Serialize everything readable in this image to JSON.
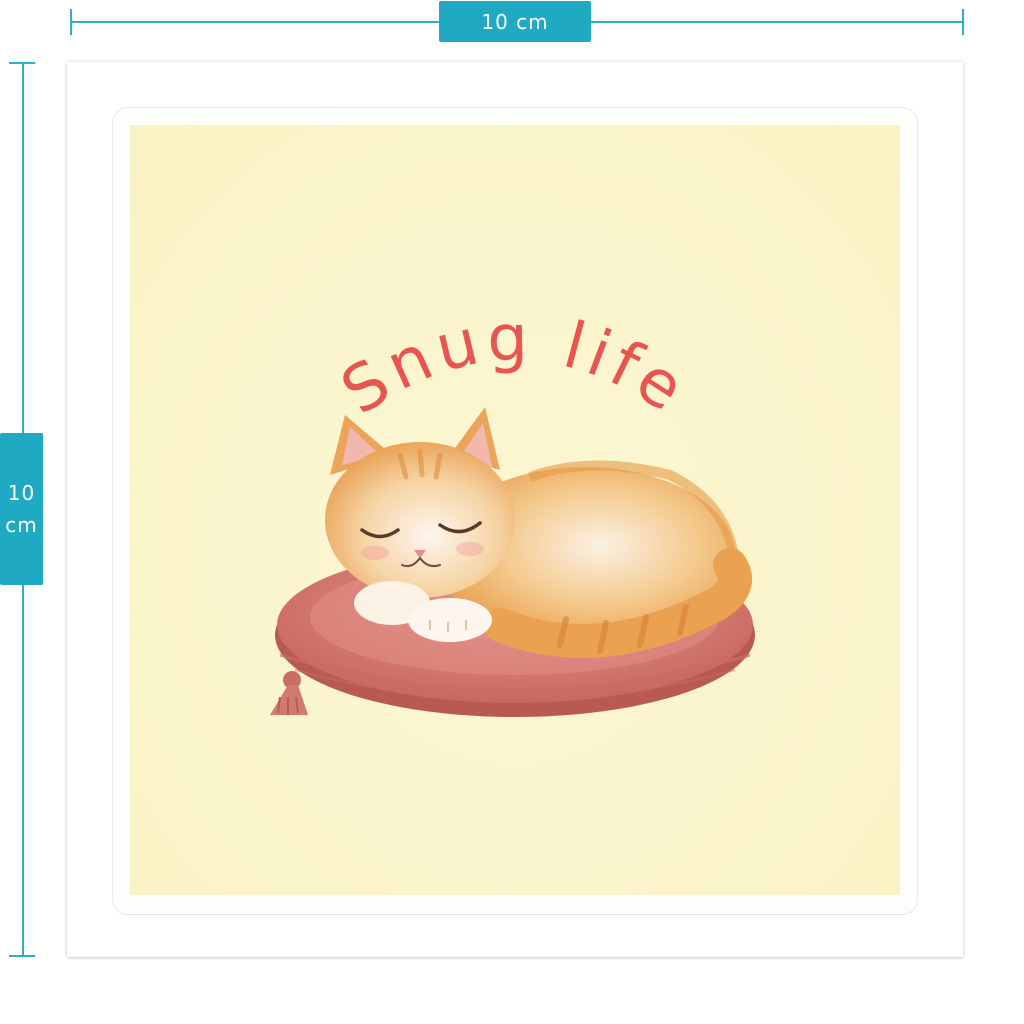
{
  "dimensions": {
    "width_label": "10 cm",
    "height_value": "10",
    "height_unit": "cm"
  },
  "sticker": {
    "caption": "Snug life",
    "colors": {
      "background": "#fbf5cd",
      "caption": "#e8554f",
      "cushion": "#d97c75",
      "cat_orange": "#eca85a",
      "cat_cream": "#fbf1e4",
      "guide": "#1fa9c3"
    }
  }
}
